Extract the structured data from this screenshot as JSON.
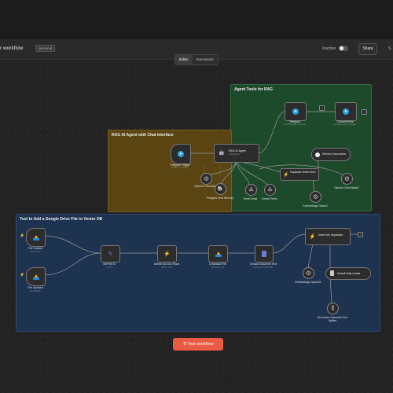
{
  "header": {
    "workflow_name": "r workflow",
    "tag": "personal",
    "status": "Inactive",
    "share_label": "Share",
    "truncated_right": "S"
  },
  "tabs": [
    {
      "label": "Editor",
      "active": true
    },
    {
      "label": "Executions",
      "active": false
    }
  ],
  "groups": {
    "agent_tools": {
      "title": "Agent Tools for RAG",
      "color": "#1e4a2c"
    },
    "rag_agent": {
      "title": "RAG AI Agent with Chat Interface",
      "color": "#5a4512"
    },
    "drive_tool": {
      "title": "Tool to Add a Google Drive File to Vector DB",
      "color": "#1e3350"
    }
  },
  "nodes": {
    "telegram_trigger": {
      "label": "Telegram Trigger",
      "sub": "Updates: message"
    },
    "ai_agent": {
      "label": "RAG AI Agent",
      "sub": "Tools Agent"
    },
    "telegram": {
      "label": "Telegram",
      "sub": "sendMessage: message"
    },
    "correct_errors": {
      "label": "Correct errors",
      "sub": "sendMessage: message"
    },
    "retrieve_documents": {
      "label": "Retrieve Documents"
    },
    "supabase_store": {
      "label": "Supabase Vector Store"
    },
    "openai_chat_model": {
      "label": "OpenAI Chat Model"
    },
    "postgres_memory": {
      "label": "Postgres Chat Memory"
    },
    "send_email": {
      "label": "Send Email"
    },
    "create_event": {
      "label": "Create Event"
    },
    "openai_chat_model1": {
      "label": "OpenAI Chat Model1"
    },
    "embeddings_openai": {
      "label": "Embeddings OpenAI"
    },
    "file_created": {
      "label": "File Created",
      "sub": "fileCreated"
    },
    "file_updated": {
      "label": "File Updated",
      "sub": "fileUpdated"
    },
    "set_file_id": {
      "label": "Set File ID",
      "sub": "manual"
    },
    "delete_old_doc_rows": {
      "label": "Delete Old Doc Rows",
      "sub": "delete: rows"
    },
    "download_file": {
      "label": "Download File",
      "sub": "download: file"
    },
    "extract_text": {
      "label": "Extract Document Text",
      "sub": "Extract From Text File"
    },
    "insert_supabase": {
      "label": "Insert into Supabase..."
    },
    "embeddings_openai1": {
      "label": "Embeddings OpenAI1"
    },
    "default_data_loader": {
      "label": "Default Data Loader"
    },
    "text_splitter": {
      "label": "Recursive Character Text Splitter"
    }
  },
  "test_button": {
    "label": "Test workflow"
  }
}
